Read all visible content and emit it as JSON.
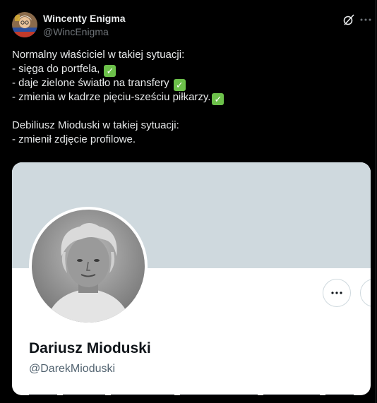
{
  "author": {
    "name": "Wincenty Enigma",
    "handle": "@WincEnigma",
    "avatar_icon": "user-avatar-icon"
  },
  "header_actions": {
    "grok_icon": "grok-icon",
    "more_icon": "more-options-icon"
  },
  "tweet": {
    "line1": "Normalny właściciel w takiej sytuacji:",
    "line2": "- sięga do portfela,",
    "line3": "- daje zielone światło na transfery",
    "line4": "- zmienia w kadrze pięciu-sześciu piłkarzy.",
    "line5": "Debiliusz Mioduski w takiej sytuacji:",
    "line6": "- zmienił zdjęcie profilowe.",
    "check_emoji": "✓"
  },
  "embedded_card": {
    "name": "Dariusz Mioduski",
    "handle": "@DarekMioduski",
    "banner_color": "#cfd9de",
    "more_icon": "more-options-icon"
  },
  "colors": {
    "background": "#000000",
    "text": "#e7e9ea",
    "muted": "#71767b",
    "check_green": "#6cc04a"
  }
}
